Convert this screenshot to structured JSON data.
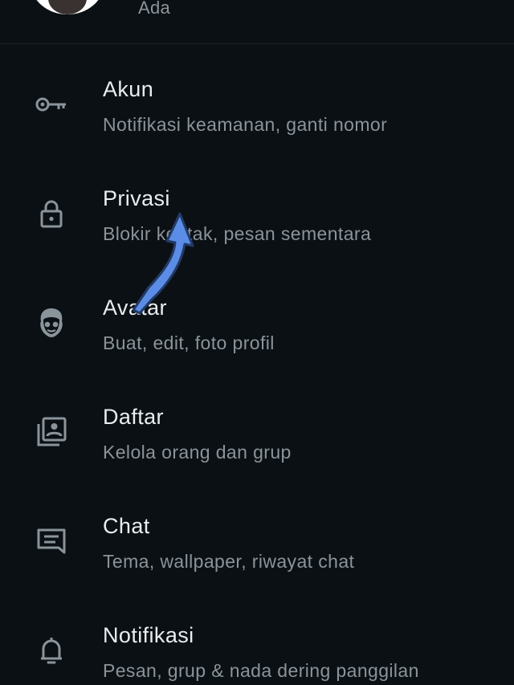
{
  "profile": {
    "status": "Ada"
  },
  "settings": {
    "items": [
      {
        "title": "Akun",
        "subtitle": "Notifikasi keamanan, ganti nomor",
        "icon": "key-icon"
      },
      {
        "title": "Privasi",
        "subtitle": "Blokir kontak, pesan sementara",
        "icon": "lock-icon"
      },
      {
        "title": "Avatar",
        "subtitle": "Buat, edit, foto profil",
        "icon": "avatar-face-icon"
      },
      {
        "title": "Daftar",
        "subtitle": "Kelola orang dan grup",
        "icon": "contact-list-icon"
      },
      {
        "title": "Chat",
        "subtitle": "Tema, wallpaper, riwayat chat",
        "icon": "chat-icon"
      },
      {
        "title": "Notifikasi",
        "subtitle": "Pesan, grup & nada dering panggilan",
        "icon": "bell-icon"
      }
    ]
  },
  "colors": {
    "background": "#0b1014",
    "title": "#e9edef",
    "subtitle": "#8a949b",
    "icon": "#8a949b",
    "annotation_arrow": "#5b8de6"
  }
}
